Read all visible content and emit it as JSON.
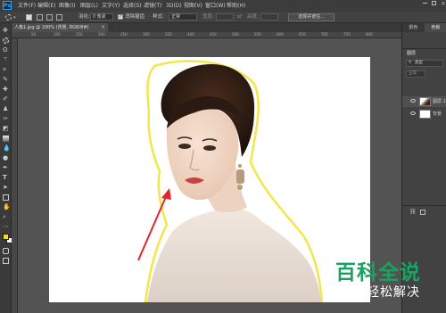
{
  "app": {
    "logo_text": "Ps",
    "menu": [
      "文件(F)",
      "编辑(E)",
      "图像(I)",
      "图层(L)",
      "文字(Y)",
      "选择(S)",
      "滤镜(T)",
      "3D(D)",
      "视图(V)",
      "窗口(W)",
      "帮助(H)"
    ]
  },
  "options": {
    "feather_label": "羽化:",
    "feather_value": "0 像素",
    "antialias_label": "消除锯齿",
    "antialias_checked": true,
    "style_label": "样式:",
    "style_value": "正常",
    "width_label": "宽度:",
    "height_label": "高度:",
    "select_mask_label": "选择并遮住..."
  },
  "document": {
    "tab_title": "人像1.jpg @ 100% (背景, RGB/8#)",
    "ruler_marks": [
      "50",
      "100",
      "150",
      "200",
      "250",
      "300",
      "350",
      "400",
      "450",
      "500",
      "550",
      "600",
      "650",
      "700",
      "750",
      "800"
    ]
  },
  "right_panel": {
    "tabs": [
      "颜色",
      "色板"
    ],
    "layers_title": "图层",
    "kind_label": "类型",
    "blend_mode": "正常",
    "layers": [
      {
        "name": "图层 1",
        "visible": true
      },
      {
        "name": "背景",
        "visible": true
      }
    ]
  },
  "colors": {
    "foreground": "#f3e100",
    "background": "#ffffff",
    "arrow": "#e0252c",
    "selection_outline": "#f2e64a"
  },
  "watermark": {
    "title": "百科全说",
    "subtitle": "助你轻松解决"
  }
}
